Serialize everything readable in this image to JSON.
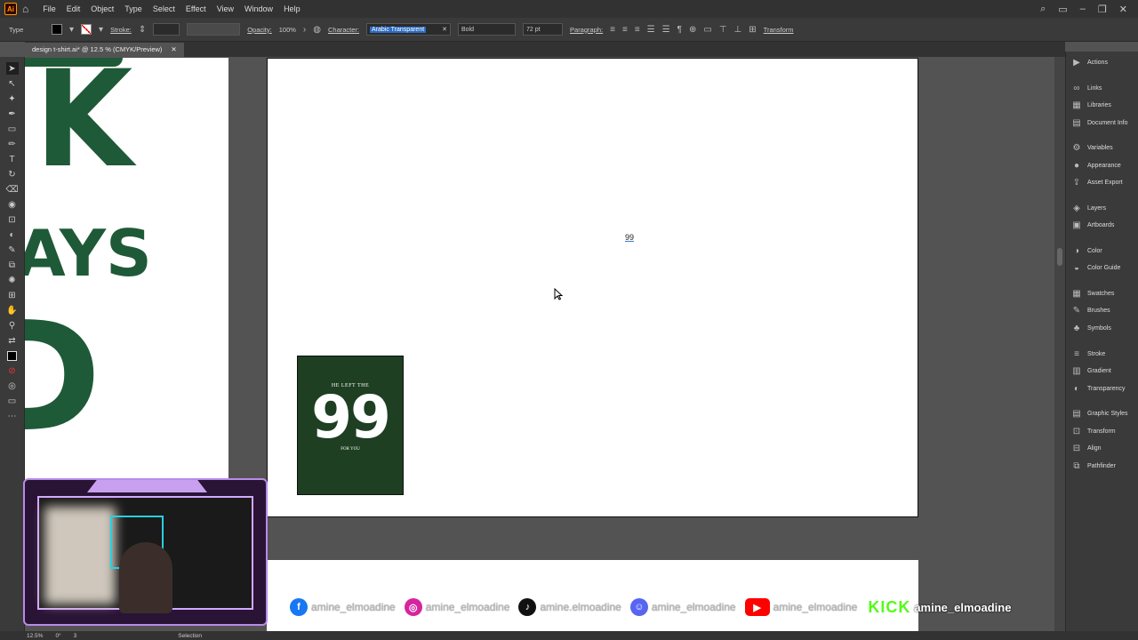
{
  "menubar": {
    "logo": "Ai",
    "items": [
      "File",
      "Edit",
      "Object",
      "Type",
      "Select",
      "Effect",
      "View",
      "Window",
      "Help"
    ]
  },
  "control": {
    "tool_label": "Type",
    "stroke_label": "Stroke:",
    "opacity_label": "Opacity:",
    "opacity_value": "100%",
    "character_label": "Character:",
    "font_family": "Arabic Transparent",
    "font_style": "Bold",
    "font_size": "72 pt",
    "paragraph_label": "Paragraph:",
    "transform_label": "Transform"
  },
  "document_tab": {
    "title": "design t-shirt.ai* @ 12.5 % (CMYK/Preview)"
  },
  "panels": [
    "Actions",
    "Links",
    "Libraries",
    "Document Info",
    "Variables",
    "Appearance",
    "Asset Export",
    "Layers",
    "Artboards",
    "Color",
    "Color Guide",
    "Swatches",
    "Brushes",
    "Symbols",
    "Stroke",
    "Gradient",
    "Transparency",
    "Graphic Styles",
    "Transform",
    "Align",
    "Pathfinder"
  ],
  "canvas": {
    "text_object": "99",
    "mini_design": {
      "line1": "HE LEFT THE",
      "number": "99",
      "line3": "FOR YOU"
    },
    "green_letters": {
      "a": "K",
      "b": "AYS",
      "c": "D"
    }
  },
  "status": {
    "zoom": "12.5%",
    "rotation": "0°",
    "artboard": "3",
    "tool": "Selection"
  },
  "social": {
    "handle": "amine_elmoadine",
    "handle_alt": "amine.elmoadine",
    "kick_label": "KICK"
  },
  "colors": {
    "accent_green": "#1e5a37",
    "kick_green": "#53fc18",
    "youtube": "#ff0000",
    "facebook": "#1877f2",
    "discord": "#5865f2"
  }
}
